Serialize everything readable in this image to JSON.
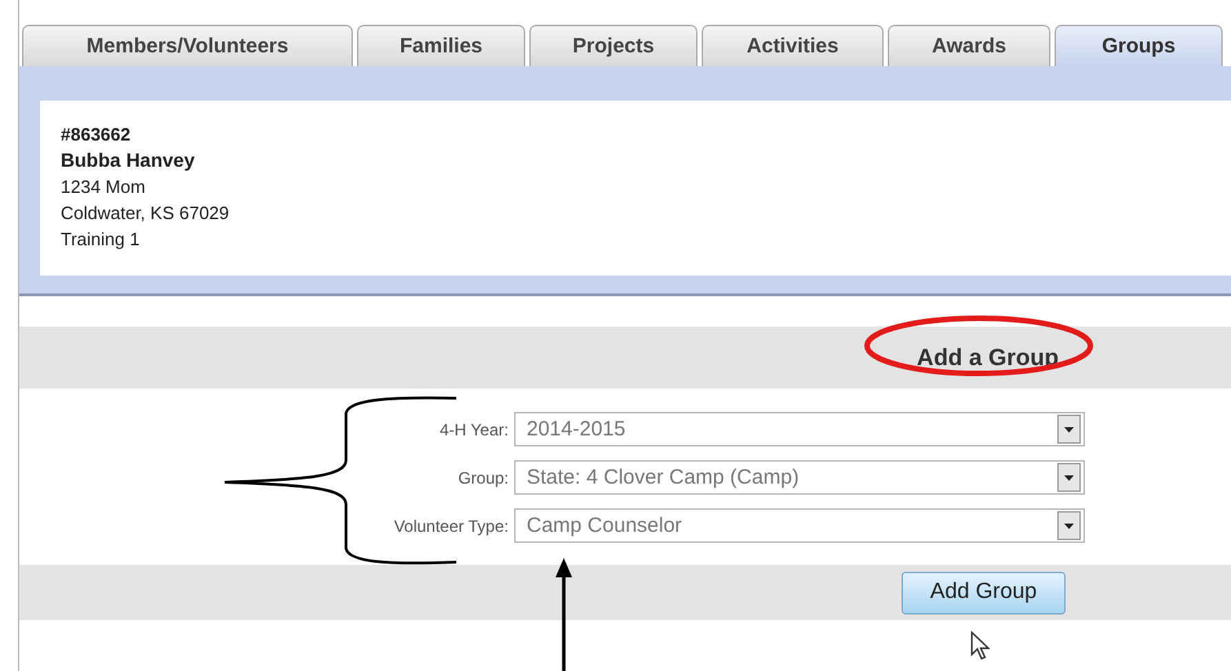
{
  "tabs": [
    {
      "label": "Members/Volunteers",
      "selected": false
    },
    {
      "label": "Families",
      "selected": false
    },
    {
      "label": "Projects",
      "selected": false
    },
    {
      "label": "Activities",
      "selected": false
    },
    {
      "label": "Awards",
      "selected": false
    },
    {
      "label": "Groups",
      "selected": true
    }
  ],
  "member": {
    "id": "#863662",
    "name": "Bubba Hanvey",
    "address_lines": [
      "1234 Mom",
      "Coldwater, KS 67029",
      "Training 1"
    ]
  },
  "section_title": "Add a Group",
  "fields": [
    {
      "label": "4-H Year:",
      "value": "2014-2015"
    },
    {
      "label": "Group:",
      "value": "State: 4 Clover Camp (Camp)"
    },
    {
      "label": "Volunteer Type:",
      "value": "Camp Counselor"
    }
  ],
  "submit_button": "Add Group"
}
